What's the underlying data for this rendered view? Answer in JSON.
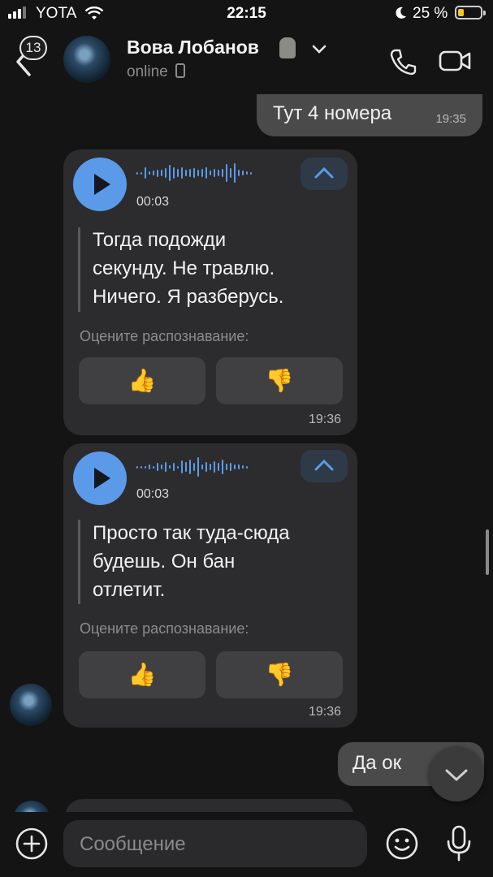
{
  "status_bar": {
    "carrier": "YOTA",
    "time": "22:15",
    "battery": "25 %"
  },
  "header": {
    "back_badge": "13",
    "contact_name": "Вова Лобанов",
    "contact_status": "online"
  },
  "messages": [
    {
      "type": "outgoing_text",
      "text": "Тут 4 номера",
      "time": "19:35"
    },
    {
      "type": "incoming_voice",
      "duration": "00:03",
      "transcript_lines": [
        "Тогда подожди",
        "секунду. Не травлю.",
        "Ничего. Я разберусь."
      ],
      "rate_label": "Оцените распознавание:",
      "like": "👍",
      "dislike": "👎",
      "time": "19:36"
    },
    {
      "type": "incoming_voice",
      "duration": "00:03",
      "transcript_lines": [
        "Просто так туда-сюда",
        "будешь. Он бан",
        "отлетит."
      ],
      "rate_label": "Оцените распознавание:",
      "like": "👍",
      "dislike": "👎",
      "time": "19:36"
    },
    {
      "type": "outgoing_text",
      "text": "Да ок"
    }
  ],
  "composer": {
    "placeholder": "Сообщение"
  },
  "colors": {
    "background": "#141414",
    "bubble_in": "#2c2c2e",
    "bubble_out": "#4a4a4a",
    "accent": "#5b9ae8"
  },
  "icons": [
    "back-chevron-icon",
    "chevron-down-icon",
    "phone-icon",
    "video-icon",
    "play-icon",
    "collapse-icon",
    "thumbs-up-icon",
    "thumbs-down-icon",
    "add-icon",
    "emoji-icon",
    "mic-icon"
  ]
}
